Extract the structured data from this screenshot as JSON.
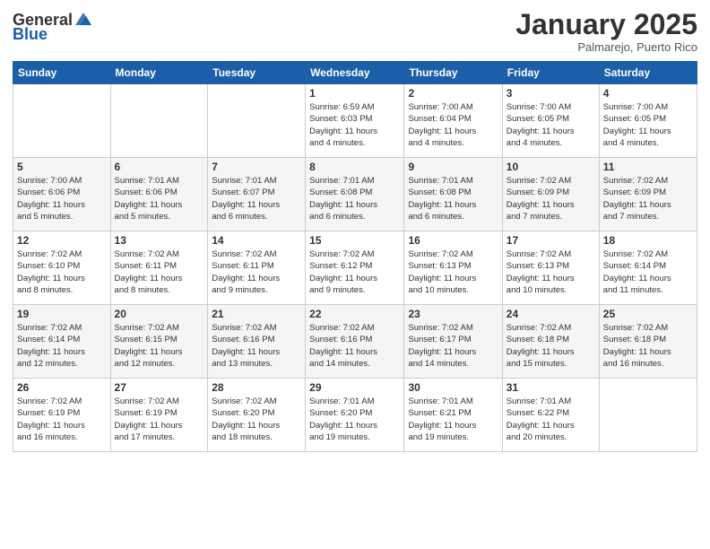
{
  "header": {
    "logo_general": "General",
    "logo_blue": "Blue",
    "month": "January 2025",
    "location": "Palmarejo, Puerto Rico"
  },
  "days_of_week": [
    "Sunday",
    "Monday",
    "Tuesday",
    "Wednesday",
    "Thursday",
    "Friday",
    "Saturday"
  ],
  "weeks": [
    [
      {
        "day": "",
        "info": ""
      },
      {
        "day": "",
        "info": ""
      },
      {
        "day": "",
        "info": ""
      },
      {
        "day": "1",
        "info": "Sunrise: 6:59 AM\nSunset: 6:03 PM\nDaylight: 11 hours\nand 4 minutes."
      },
      {
        "day": "2",
        "info": "Sunrise: 7:00 AM\nSunset: 6:04 PM\nDaylight: 11 hours\nand 4 minutes."
      },
      {
        "day": "3",
        "info": "Sunrise: 7:00 AM\nSunset: 6:05 PM\nDaylight: 11 hours\nand 4 minutes."
      },
      {
        "day": "4",
        "info": "Sunrise: 7:00 AM\nSunset: 6:05 PM\nDaylight: 11 hours\nand 4 minutes."
      }
    ],
    [
      {
        "day": "5",
        "info": "Sunrise: 7:00 AM\nSunset: 6:06 PM\nDaylight: 11 hours\nand 5 minutes."
      },
      {
        "day": "6",
        "info": "Sunrise: 7:01 AM\nSunset: 6:06 PM\nDaylight: 11 hours\nand 5 minutes."
      },
      {
        "day": "7",
        "info": "Sunrise: 7:01 AM\nSunset: 6:07 PM\nDaylight: 11 hours\nand 6 minutes."
      },
      {
        "day": "8",
        "info": "Sunrise: 7:01 AM\nSunset: 6:08 PM\nDaylight: 11 hours\nand 6 minutes."
      },
      {
        "day": "9",
        "info": "Sunrise: 7:01 AM\nSunset: 6:08 PM\nDaylight: 11 hours\nand 6 minutes."
      },
      {
        "day": "10",
        "info": "Sunrise: 7:02 AM\nSunset: 6:09 PM\nDaylight: 11 hours\nand 7 minutes."
      },
      {
        "day": "11",
        "info": "Sunrise: 7:02 AM\nSunset: 6:09 PM\nDaylight: 11 hours\nand 7 minutes."
      }
    ],
    [
      {
        "day": "12",
        "info": "Sunrise: 7:02 AM\nSunset: 6:10 PM\nDaylight: 11 hours\nand 8 minutes."
      },
      {
        "day": "13",
        "info": "Sunrise: 7:02 AM\nSunset: 6:11 PM\nDaylight: 11 hours\nand 8 minutes."
      },
      {
        "day": "14",
        "info": "Sunrise: 7:02 AM\nSunset: 6:11 PM\nDaylight: 11 hours\nand 9 minutes."
      },
      {
        "day": "15",
        "info": "Sunrise: 7:02 AM\nSunset: 6:12 PM\nDaylight: 11 hours\nand 9 minutes."
      },
      {
        "day": "16",
        "info": "Sunrise: 7:02 AM\nSunset: 6:13 PM\nDaylight: 11 hours\nand 10 minutes."
      },
      {
        "day": "17",
        "info": "Sunrise: 7:02 AM\nSunset: 6:13 PM\nDaylight: 11 hours\nand 10 minutes."
      },
      {
        "day": "18",
        "info": "Sunrise: 7:02 AM\nSunset: 6:14 PM\nDaylight: 11 hours\nand 11 minutes."
      }
    ],
    [
      {
        "day": "19",
        "info": "Sunrise: 7:02 AM\nSunset: 6:14 PM\nDaylight: 11 hours\nand 12 minutes."
      },
      {
        "day": "20",
        "info": "Sunrise: 7:02 AM\nSunset: 6:15 PM\nDaylight: 11 hours\nand 12 minutes."
      },
      {
        "day": "21",
        "info": "Sunrise: 7:02 AM\nSunset: 6:16 PM\nDaylight: 11 hours\nand 13 minutes."
      },
      {
        "day": "22",
        "info": "Sunrise: 7:02 AM\nSunset: 6:16 PM\nDaylight: 11 hours\nand 14 minutes."
      },
      {
        "day": "23",
        "info": "Sunrise: 7:02 AM\nSunset: 6:17 PM\nDaylight: 11 hours\nand 14 minutes."
      },
      {
        "day": "24",
        "info": "Sunrise: 7:02 AM\nSunset: 6:18 PM\nDaylight: 11 hours\nand 15 minutes."
      },
      {
        "day": "25",
        "info": "Sunrise: 7:02 AM\nSunset: 6:18 PM\nDaylight: 11 hours\nand 16 minutes."
      }
    ],
    [
      {
        "day": "26",
        "info": "Sunrise: 7:02 AM\nSunset: 6:19 PM\nDaylight: 11 hours\nand 16 minutes."
      },
      {
        "day": "27",
        "info": "Sunrise: 7:02 AM\nSunset: 6:19 PM\nDaylight: 11 hours\nand 17 minutes."
      },
      {
        "day": "28",
        "info": "Sunrise: 7:02 AM\nSunset: 6:20 PM\nDaylight: 11 hours\nand 18 minutes."
      },
      {
        "day": "29",
        "info": "Sunrise: 7:01 AM\nSunset: 6:20 PM\nDaylight: 11 hours\nand 19 minutes."
      },
      {
        "day": "30",
        "info": "Sunrise: 7:01 AM\nSunset: 6:21 PM\nDaylight: 11 hours\nand 19 minutes."
      },
      {
        "day": "31",
        "info": "Sunrise: 7:01 AM\nSunset: 6:22 PM\nDaylight: 11 hours\nand 20 minutes."
      },
      {
        "day": "",
        "info": ""
      }
    ]
  ]
}
